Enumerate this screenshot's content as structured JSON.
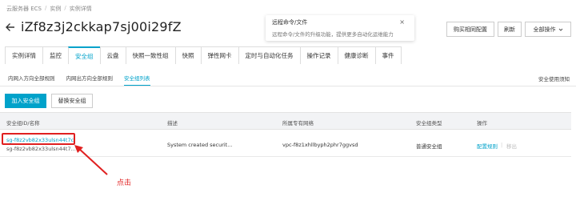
{
  "breadcrumb": {
    "items": [
      "云服务器 ECS",
      "实例",
      "实例详情"
    ],
    "separator": "/"
  },
  "page": {
    "title": "iZf8z3j2ckkap7sj00i29fZ"
  },
  "notice": {
    "title": "远程命令/文件",
    "text": "远程命令/文件的升级功能，提供更多自动化运维能力",
    "close": "×"
  },
  "toolbar": {
    "buy_same": "购买相同配置",
    "refresh": "刷新",
    "all_actions": "全部操作"
  },
  "tabs": [
    {
      "label": "实例详情",
      "active": false
    },
    {
      "label": "监控",
      "active": false
    },
    {
      "label": "安全组",
      "active": true
    },
    {
      "label": "云盘",
      "active": false
    },
    {
      "label": "快照一致性组",
      "active": false
    },
    {
      "label": "快照",
      "active": false
    },
    {
      "label": "弹性网卡",
      "active": false
    },
    {
      "label": "定时与自动化任务",
      "active": false
    },
    {
      "label": "操作记录",
      "active": false
    },
    {
      "label": "健康诊断",
      "active": false
    },
    {
      "label": "事件",
      "active": false
    }
  ],
  "subtabs": [
    {
      "label": "内网入方向全部规则",
      "active": false
    },
    {
      "label": "内网出方向全部规则",
      "active": false
    },
    {
      "label": "安全组列表",
      "active": true
    }
  ],
  "help_link": "安全使用须知",
  "actions": {
    "add_group": "加入安全组",
    "replace_group": "替换安全组"
  },
  "table": {
    "headers": [
      "安全组ID/名称",
      "描述",
      "所属专有网络",
      "安全组类型",
      "操作"
    ],
    "rows": [
      {
        "id": "sg-f8z2vb82x33ulsn44t7c",
        "name": "sg-f8z2vb82x33ulsn44t7...",
        "description": "System created securit...",
        "vpc": "vpc-f8z1xhllbyph2phr7ggvsd",
        "type": "普通安全组",
        "action_config": "配置规则",
        "action_sep": "|",
        "action_remove": "移出"
      }
    ]
  },
  "annotation": {
    "label": "点击",
    "color": "#e02020"
  },
  "colors": {
    "accent": "#00a2ca",
    "annotation": "#e02020"
  }
}
